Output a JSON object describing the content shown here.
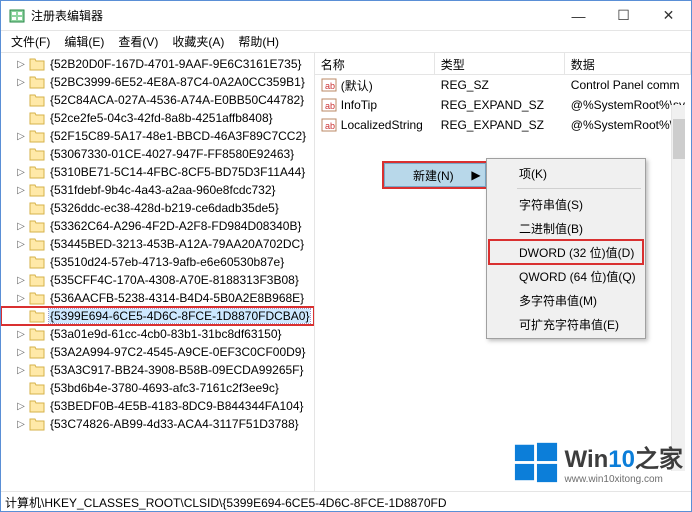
{
  "title": "注册表编辑器",
  "menus": [
    "文件(F)",
    "编辑(E)",
    "查看(V)",
    "收藏夹(A)",
    "帮助(H)"
  ],
  "tree": [
    "{52B20D0F-167D-4701-9AAF-9E6C3161E735}",
    "{52BC3999-6E52-4E8A-87C4-0A2A0CC359B1}",
    "{52C84ACA-027A-4536-A74A-E0BB50C44782}",
    "{52ce2fe5-04c3-42fd-8a8b-4251affb8408}",
    "{52F15C89-5A17-48e1-BBCD-46A3F89C7CC2}",
    "{53067330-01CE-4027-947F-FF8580E92463}",
    "{5310BE71-5C14-4FBC-8CF5-BD75D3F11A44}",
    "{531fdebf-9b4c-4a43-a2aa-960e8fcdc732}",
    "{5326ddc-ec38-428d-b219-ce6dadb35de5}",
    "{53362C64-A296-4F2D-A2F8-FD984D08340B}",
    "{53445BED-3213-453B-A12A-79AA20A702DC}",
    "{53510d24-57eb-4713-9afb-e6e60530b87e}",
    "{535CFF4C-170A-4308-A70E-8188313F3B08}",
    "{536AACFB-5238-4314-B4D4-5B0A2E8B968E}",
    "{5399E694-6CE5-4D6C-8FCE-1D8870FDCBA0}",
    "{53a01e9d-61cc-4cb0-83b1-31bc8df63150}",
    "{53A2A994-97C2-4545-A9CE-0EF3C0CF00D9}",
    "{53A3C917-BB24-3908-B58B-09ECDA99265F}",
    "{53bd6b4e-3780-4693-afc3-7161c2f3ee9c}",
    "{53BEDF0B-4E5B-4183-8DC9-B844344FA104}",
    "{53C74826-AB99-4d33-ACA4-3117F51D3788}"
  ],
  "tree_exp": [
    true,
    true,
    false,
    false,
    true,
    false,
    true,
    true,
    false,
    true,
    true,
    false,
    true,
    true,
    false,
    true,
    true,
    true,
    false,
    true,
    true
  ],
  "selected_index": 14,
  "list_header": {
    "name": "名称",
    "type": "类型",
    "data": "数据"
  },
  "list_rows": [
    {
      "icon": "str",
      "name": "(默认)",
      "type": "REG_SZ",
      "data": "Control Panel comm"
    },
    {
      "icon": "str",
      "name": "InfoTip",
      "type": "REG_EXPAND_SZ",
      "data": "@%SystemRoot%\\sy"
    },
    {
      "icon": "str",
      "name": "LocalizedString",
      "type": "REG_EXPAND_SZ",
      "data": "@%SystemRoot%\\sy"
    }
  ],
  "context": {
    "parent": "新建(N)"
  },
  "submenu": [
    {
      "label": "项(K)",
      "sep_after": true
    },
    {
      "label": "字符串值(S)"
    },
    {
      "label": "二进制值(B)"
    },
    {
      "label": "DWORD (32 位)值(D)",
      "highlight": true
    },
    {
      "label": "QWORD (64 位)值(Q)"
    },
    {
      "label": "多字符串值(M)"
    },
    {
      "label": "可扩充字符串值(E)"
    }
  ],
  "status": "计算机\\HKEY_CLASSES_ROOT\\CLSID\\{5399E694-6CE5-4D6C-8FCE-1D8870FD",
  "watermark": {
    "brand_a": "Win",
    "brand_b": "10",
    "brand_c": "之家",
    "url": "www.win10xitong.com"
  }
}
